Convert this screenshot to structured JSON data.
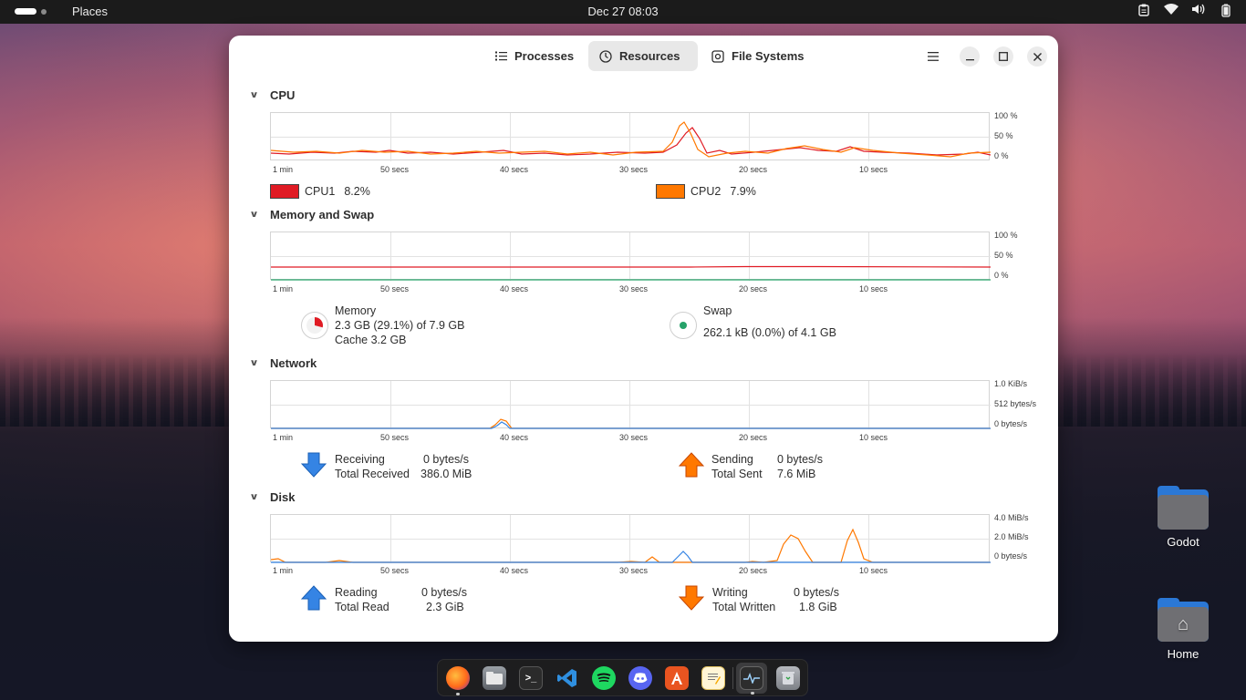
{
  "topbar": {
    "places": "Places",
    "clock": "Dec 27  08:03",
    "tray_icons": [
      "clipboard-icon",
      "wifi-icon",
      "volume-icon",
      "battery-icon"
    ]
  },
  "window": {
    "tabs": [
      {
        "label": "Processes",
        "icon": "list-icon",
        "active": false
      },
      {
        "label": "Resources",
        "icon": "gauge-icon",
        "active": true
      },
      {
        "label": "File Systems",
        "icon": "disk-icon",
        "active": false
      }
    ],
    "controls": [
      "menu-icon",
      "minimize-icon",
      "maximize-icon",
      "close-icon"
    ]
  },
  "time_labels": [
    "1 min",
    "50 secs",
    "40 secs",
    "30 secs",
    "20 secs",
    "10 secs"
  ],
  "cpu": {
    "title": "CPU",
    "y_labels": [
      "100 %",
      "50 %",
      "0 %"
    ],
    "cpu1_label": "CPU1",
    "cpu1_value": "8.2%",
    "cpu1_color": "#e01b24",
    "cpu2_label": "CPU2",
    "cpu2_value": "7.9%",
    "cpu2_color": "#ff7800"
  },
  "memory": {
    "title": "Memory and Swap",
    "y_labels": [
      "100 %",
      "50 %",
      "0 %"
    ],
    "memory_label": "Memory",
    "memory_line1": "2.3 GB (29.1%) of 7.9 GB",
    "memory_line2": "Cache 3.2 GB",
    "memory_fraction": 0.291,
    "memory_color": "#e01b24",
    "swap_label": "Swap",
    "swap_line1": "262.1 kB (0.0%) of 4.1 GB",
    "swap_fraction": 0.0,
    "swap_color": "#26a269"
  },
  "network": {
    "title": "Network",
    "y_labels": [
      "1.0 KiB/s",
      "512 bytes/s",
      "0 bytes/s"
    ],
    "receiving_label": "Receiving",
    "receiving_value": "0 bytes/s",
    "total_received_label": "Total Received",
    "total_received_value": "386.0 MiB",
    "sending_label": "Sending",
    "sending_value": "0 bytes/s",
    "total_sent_label": "Total Sent",
    "total_sent_value": "7.6 MiB"
  },
  "disk": {
    "title": "Disk",
    "y_labels": [
      "4.0 MiB/s",
      "2.0 MiB/s",
      "0 bytes/s"
    ],
    "reading_label": "Reading",
    "reading_value": "0 bytes/s",
    "total_read_label": "Total Read",
    "total_read_value": "2.3 GiB",
    "writing_label": "Writing",
    "writing_value": "0 bytes/s",
    "total_written_label": "Total Written",
    "total_written_value": "1.8 GiB"
  },
  "desktop": {
    "icons": [
      {
        "label": "Godot"
      },
      {
        "label": "Home"
      }
    ]
  },
  "dock": {
    "apps": [
      "firefox-icon",
      "files-icon",
      "terminal-icon",
      "vscode-icon",
      "spotify-icon",
      "discord-icon",
      "app-center-icon",
      "text-editor-icon",
      "system-monitor-icon",
      "trash-icon"
    ]
  }
}
